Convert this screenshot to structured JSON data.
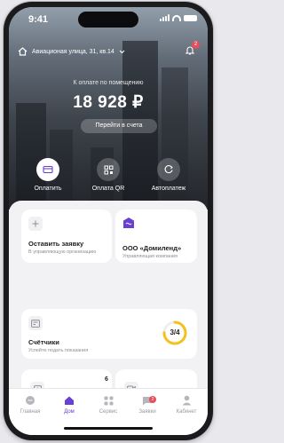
{
  "status_bar": {
    "time": "9:41"
  },
  "header": {
    "address": "Авиационая улица, 31, кв.14",
    "notifications_count": "2"
  },
  "balance": {
    "label": "К оплате по помещению",
    "amount": "18 928 ₽",
    "accounts_button": "Перейти в счета"
  },
  "quick_actions": [
    {
      "label": "Оплатить",
      "icon": "card-icon"
    },
    {
      "label": "Оплата QR",
      "icon": "qr-icon"
    },
    {
      "label": "Автоплатеж",
      "icon": "autopay-icon"
    }
  ],
  "cards": {
    "request": {
      "title": "Оставить заявку",
      "subtitle": "В управляющую организацию"
    },
    "company": {
      "title": "ООО «Домиленд»",
      "subtitle": "Управляющая компания"
    },
    "meters": {
      "title": "Счётчики",
      "subtitle": "Успейте подать показания",
      "progress": "3/4",
      "progress_fraction": 0.75
    },
    "small_left_count": "6"
  },
  "tabbar": {
    "items": [
      {
        "label": "Главная",
        "icon": "chat-bubble-icon"
      },
      {
        "label": "Дом",
        "icon": "home-icon"
      },
      {
        "label": "Сервис",
        "icon": "grid-icon"
      },
      {
        "label": "Заявки",
        "icon": "message-icon",
        "badge": "2"
      },
      {
        "label": "Кабинет",
        "icon": "person-icon"
      }
    ]
  },
  "colors": {
    "accent": "#6a3fd1",
    "progress": "#f4c21c",
    "badge": "#e84d5b"
  }
}
